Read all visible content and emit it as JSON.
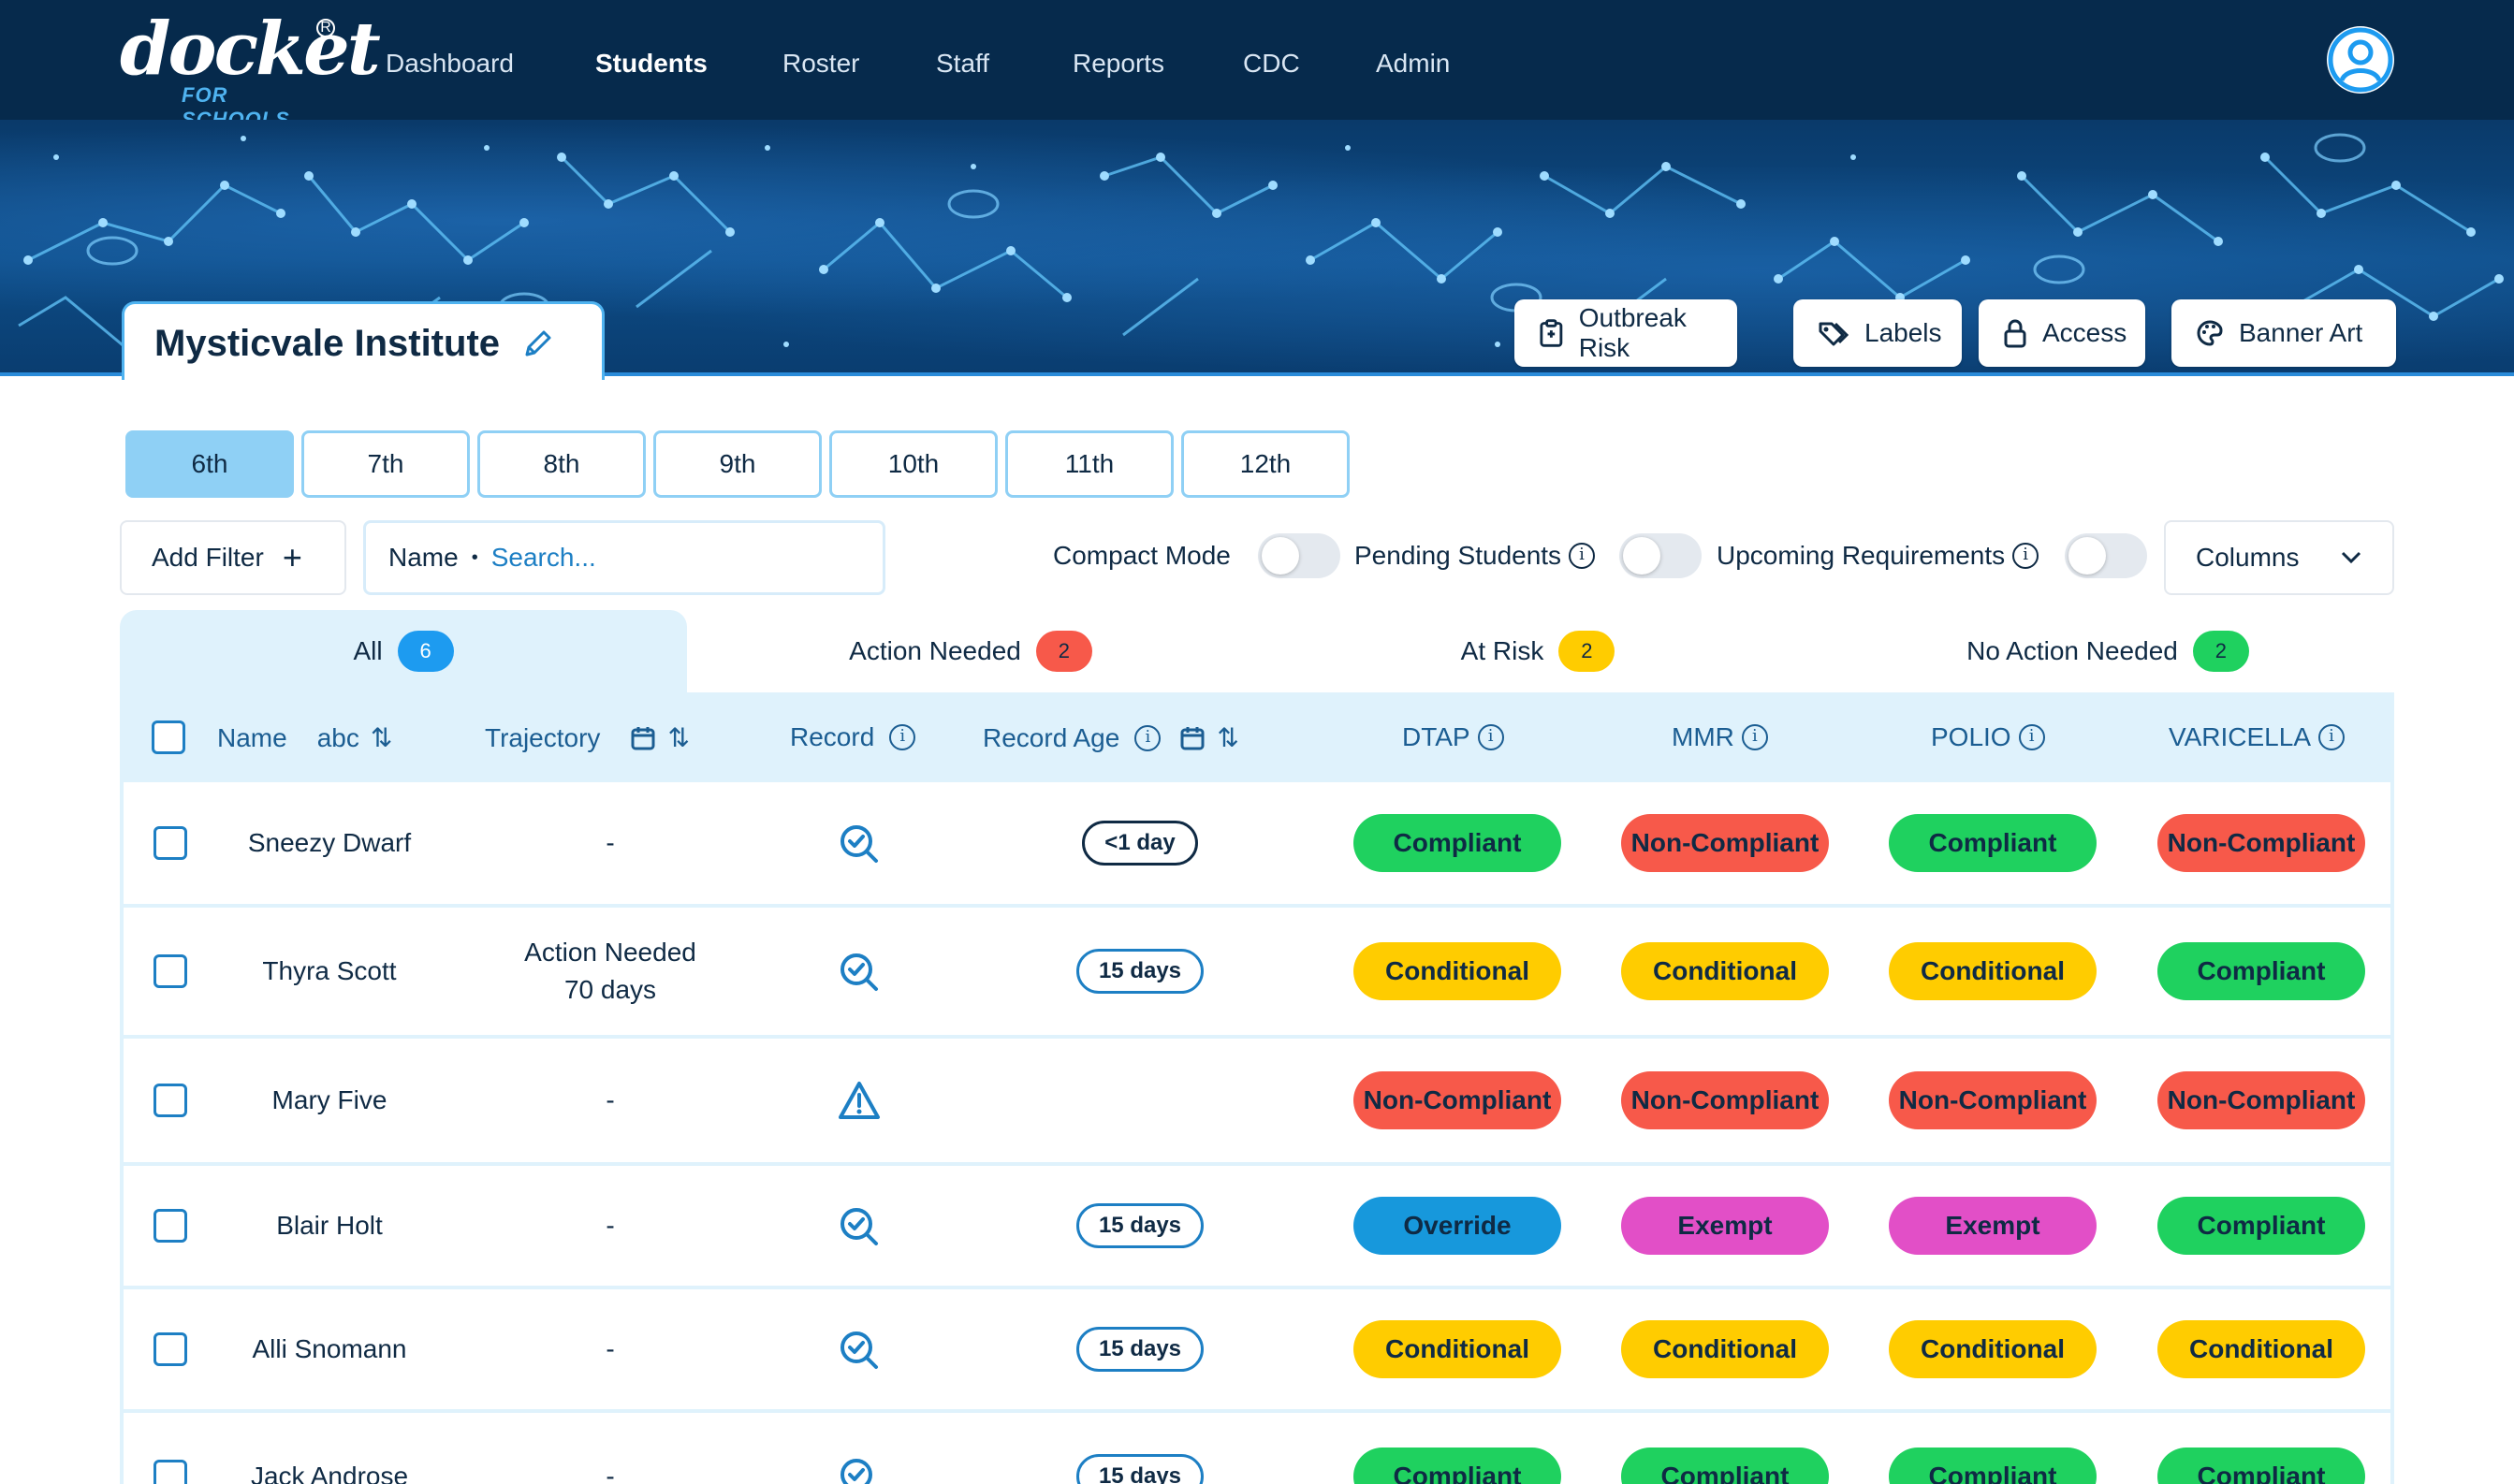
{
  "brand": {
    "logo_text": "docket",
    "logo_sub": "FOR SCHOOLS"
  },
  "nav": {
    "items": [
      {
        "label": "Dashboard",
        "active": false
      },
      {
        "label": "Students",
        "active": true
      },
      {
        "label": "Roster",
        "active": false
      },
      {
        "label": "Staff",
        "active": false
      },
      {
        "label": "Reports",
        "active": false
      },
      {
        "label": "CDC",
        "active": false
      },
      {
        "label": "Admin",
        "active": false
      }
    ],
    "user_icon": "user-circle-icon"
  },
  "school": {
    "name": "Mysticvale Institute",
    "edit_icon": "pencil-icon"
  },
  "banner_buttons": [
    {
      "label": "Outbreak Risk",
      "icon": "clipboard-icon"
    },
    {
      "label": "Labels",
      "icon": "tags-icon"
    },
    {
      "label": "Access",
      "icon": "lock-icon"
    },
    {
      "label": "Banner Art",
      "icon": "palette-icon"
    }
  ],
  "grades": [
    {
      "label": "6th",
      "active": true
    },
    {
      "label": "7th",
      "active": false
    },
    {
      "label": "8th",
      "active": false
    },
    {
      "label": "9th",
      "active": false
    },
    {
      "label": "10th",
      "active": false
    },
    {
      "label": "11th",
      "active": false
    },
    {
      "label": "12th",
      "active": false
    }
  ],
  "filters": {
    "add_filter_label": "Add Filter",
    "search_field_label": "Name",
    "search_placeholder": "Search...",
    "compact_mode_label": "Compact Mode",
    "pending_students_label": "Pending Students",
    "upcoming_requirements_label": "Upcoming Requirements",
    "columns_label": "Columns"
  },
  "status_tabs": [
    {
      "label": "All",
      "count": "6",
      "active": true,
      "color": "#1d9bf0"
    },
    {
      "label": "Action Needed",
      "count": "2",
      "active": false,
      "color": "#f7594a"
    },
    {
      "label": "At Risk",
      "count": "2",
      "active": false,
      "color": "#ffcc00"
    },
    {
      "label": "No Action Needed",
      "count": "2",
      "active": false,
      "color": "#1fd15f"
    }
  ],
  "table": {
    "headers": {
      "name": "Name",
      "name_sort": "abc",
      "trajectory": "Trajectory",
      "record": "Record",
      "record_age": "Record Age",
      "dtap": "DTAP",
      "mmr": "MMR",
      "polio": "POLIO",
      "varicella": "VARICELLA"
    },
    "rows": [
      {
        "name": "Sneezy Dwarf",
        "trajectory": [
          "-"
        ],
        "record_icon": "magnify-check-icon",
        "record_age": "<1 day",
        "dtap": "Compliant",
        "mmr": "Non-Compliant",
        "polio": "Compliant",
        "varicella": "Non-Compliant"
      },
      {
        "name": "Thyra Scott",
        "trajectory": [
          "Action Needed",
          "70 days"
        ],
        "record_icon": "magnify-check-icon",
        "record_age": "15 days",
        "dtap": "Conditional",
        "mmr": "Conditional",
        "polio": "Conditional",
        "varicella": "Compliant"
      },
      {
        "name": "Mary Five",
        "trajectory": [
          "-"
        ],
        "record_icon": "warning-triangle-icon",
        "record_age": "",
        "dtap": "Non-Compliant",
        "mmr": "Non-Compliant",
        "polio": "Non-Compliant",
        "varicella": "Non-Compliant"
      },
      {
        "name": "Blair Holt",
        "trajectory": [
          "-"
        ],
        "record_icon": "magnify-check-icon",
        "record_age": "15 days",
        "dtap": "Override",
        "mmr": "Exempt",
        "polio": "Exempt",
        "varicella": "Compliant"
      },
      {
        "name": "Alli Snomann",
        "trajectory": [
          "-"
        ],
        "record_icon": "magnify-check-icon",
        "record_age": "15 days",
        "dtap": "Conditional",
        "mmr": "Conditional",
        "polio": "Conditional",
        "varicella": "Conditional"
      },
      {
        "name": "Jack Androse",
        "trajectory": [
          "-"
        ],
        "record_icon": "magnify-check-icon",
        "record_age": "15 days",
        "dtap": "Compliant",
        "mmr": "Compliant",
        "polio": "Compliant",
        "varicella": "Compliant"
      }
    ]
  },
  "status_colors": {
    "Compliant": "#1fd15f",
    "Non-Compliant": "#f7594a",
    "Conditional": "#ffcc00",
    "Override": "#1798dc",
    "Exempt": "#e24fc7"
  }
}
